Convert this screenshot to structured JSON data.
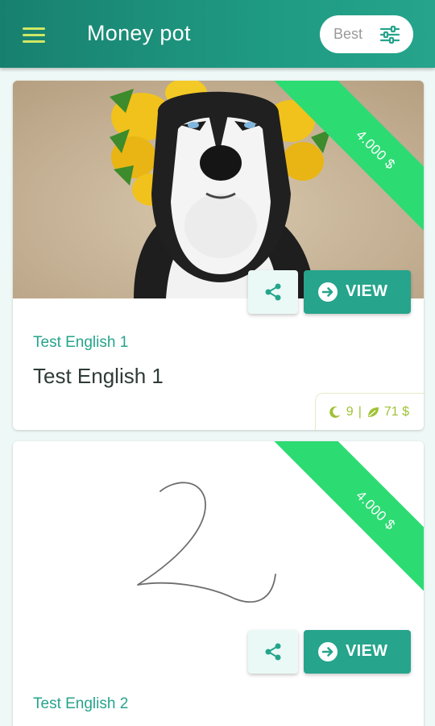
{
  "header": {
    "title": "Money pot",
    "sort_label": "Best",
    "menu_icon": "hamburger-menu-icon",
    "filter_icon": "sliders-icon"
  },
  "colors": {
    "primary": "#1f9a82",
    "accent": "#26a48c",
    "ribbon": "#2ddb73",
    "stat_lime": "#9fc234"
  },
  "cards": [
    {
      "ribbon": "4.000 $",
      "subtitle": "Test English 1",
      "title": "Test English 1",
      "view_label": "VIEW",
      "stat_count": "9",
      "stat_separator": "|",
      "stat_amount": "71 $",
      "image": "husky-dog-with-flower-crown-photo"
    },
    {
      "ribbon": "4.000 $",
      "subtitle": "Test English 2",
      "view_label": "VIEW",
      "image": "handwritten-number-2-sketch"
    }
  ]
}
